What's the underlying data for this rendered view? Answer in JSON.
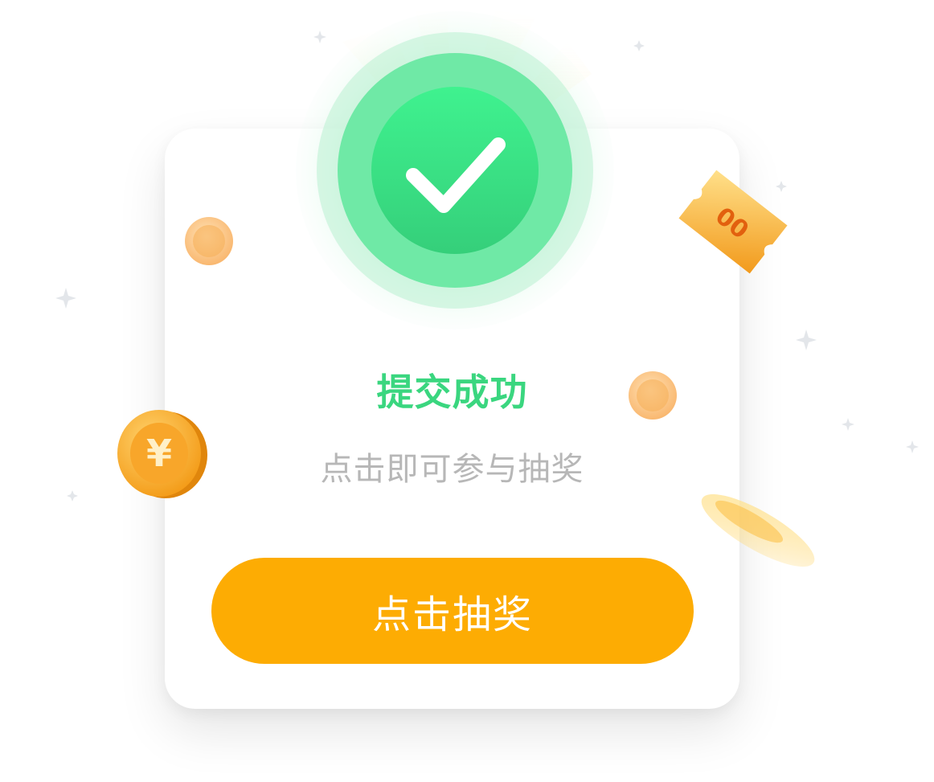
{
  "dialog": {
    "title": "提交成功",
    "subtitle": "点击即可参与抽奖",
    "button_label": "点击抽奖"
  },
  "decor": {
    "coin_symbol": "¥",
    "ticket_text": "00"
  },
  "colors": {
    "success_green": "#3ad67f",
    "button_orange": "#fdac03",
    "subtitle_gray": "#b7b7b7",
    "coin_gold": "#f7a52a"
  },
  "icons": {
    "badge": "check-icon"
  }
}
